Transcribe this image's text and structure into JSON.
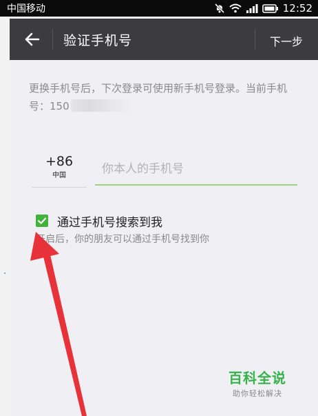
{
  "status_bar": {
    "carrier": "中国移动",
    "time": "12:52"
  },
  "header": {
    "title": "验证手机号",
    "next_label": "下一步"
  },
  "main": {
    "info_text": "更换手机号后，下次登录可使用新手机号登录。当前手机号：150",
    "country_code": "+86",
    "country_name": "中国",
    "phone_placeholder": "你本人的手机号",
    "search_option": {
      "label": "通过手机号搜索到我",
      "hint": "开启后，你的朋友可以通过手机号找到你",
      "checked": true
    }
  },
  "watermark": {
    "main": "百科全说",
    "sub": "助你轻松解决"
  },
  "colors": {
    "accent_green": "#41b33b",
    "header_bg": "#3b3b40",
    "arrow_red": "#e8323a"
  }
}
